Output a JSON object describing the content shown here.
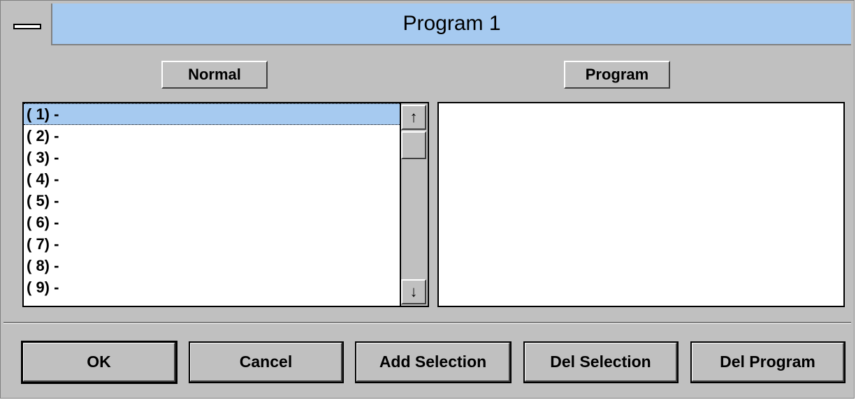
{
  "window": {
    "title": "Program 1"
  },
  "headers": {
    "normal": "Normal",
    "program": "Program"
  },
  "normal_list": {
    "items": [
      "( 1) -",
      "( 2) -",
      "( 3) -",
      "( 4) -",
      "( 5) -",
      "( 6) -",
      "( 7) -",
      "( 8) -",
      "( 9) -"
    ],
    "selected_index": 0
  },
  "scrollbar": {
    "up_icon": "↑",
    "down_icon": "↓"
  },
  "program_list": {
    "items": []
  },
  "buttons": {
    "ok": "OK",
    "cancel": "Cancel",
    "add_selection": "Add Selection",
    "del_selection": "Del Selection",
    "del_program": "Del Program"
  },
  "colors": {
    "titlebar": "#a6caf0",
    "face": "#c0c0c0",
    "selection": "#a6caf0"
  }
}
